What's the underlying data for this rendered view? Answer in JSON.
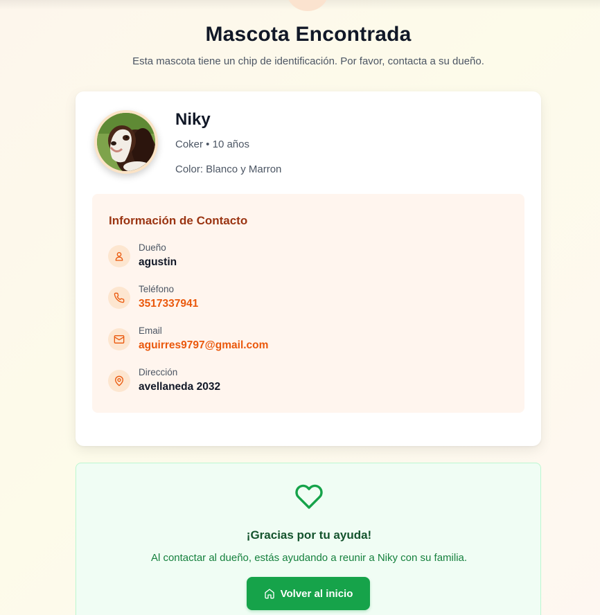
{
  "page": {
    "title": "Mascota Encontrada",
    "subtitle": "Esta mascota tiene un chip de identificación. Por favor, contacta a su dueño."
  },
  "pet": {
    "name": "Niky",
    "breed_age": "Coker • 10 años",
    "color": "Color: Blanco y Marron",
    "photo_icon": "dog-photo"
  },
  "contact": {
    "title": "Información de Contacto",
    "owner": {
      "label": "Dueño",
      "value": "agustin",
      "icon": "user-icon"
    },
    "phone": {
      "label": "Teléfono",
      "value": "3517337941",
      "icon": "phone-icon"
    },
    "email": {
      "label": "Email",
      "value": "aguirres9797@gmail.com",
      "icon": "mail-icon"
    },
    "address": {
      "label": "Dirección",
      "value": "avellaneda 2032",
      "icon": "map-pin-icon"
    }
  },
  "thanks": {
    "title": "¡Gracias por tu ayuda!",
    "text": "Al contactar al dueño, estás ayudando a reunir a Niky con su familia.",
    "button_label": "Volver al inicio",
    "icon": "heart-icon"
  },
  "colors": {
    "accent": "#ea580c",
    "contact_title": "#9a3412",
    "success": "#16a34a",
    "success_bg": "#f0fdf4"
  }
}
